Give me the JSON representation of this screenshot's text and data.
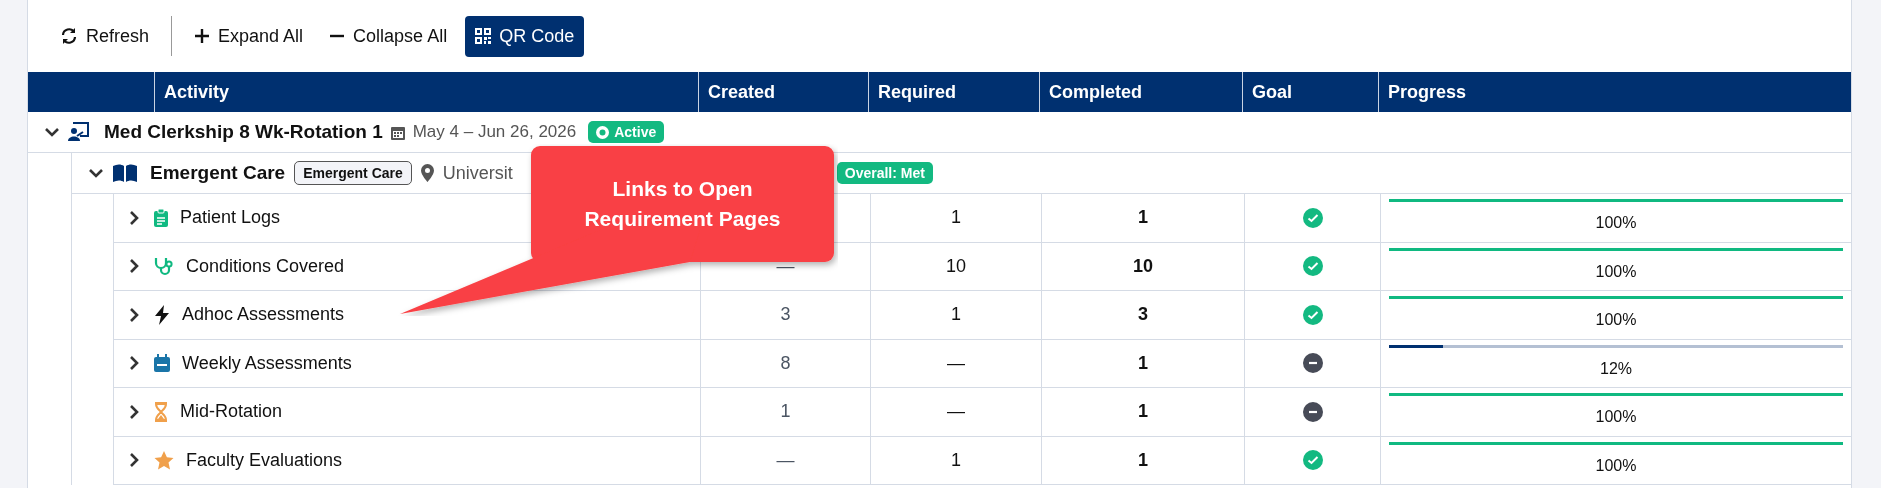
{
  "toolbar": {
    "buttons": [
      {
        "label": "Refresh",
        "kind": "refresh"
      },
      {
        "label": "Expand All",
        "kind": "expand"
      },
      {
        "label": "Collapse All",
        "kind": "collapse"
      },
      {
        "label": "QR Code",
        "kind": "qr"
      }
    ]
  },
  "table": {
    "columns": [
      "Activity",
      "Created",
      "Required",
      "Completed",
      "Goal",
      "Progress"
    ],
    "groups": [
      {
        "title": "Med Clerkship 8 Wk-Rotation 1",
        "dates": "May 4 – Jun 26, 2026",
        "status": "Active",
        "expanded": true,
        "children": [
          {
            "title": "Emergent Care",
            "tag": "Emergent Care",
            "location": "Universit",
            "overall": "Overall: Met",
            "expanded": true,
            "children": [
              {
                "name": "Patient Logs",
                "expanded": false,
                "required": "1",
                "completed": "1",
                "goal_met": true,
                "progress": {
                  "level": 1,
                  "label": "100%"
                }
              },
              {
                "name": "Conditions Covered",
                "expanded": false,
                "created": "—",
                "required": "10",
                "completed": "10",
                "goal_met": true,
                "progress": {
                  "level": 1,
                  "label": "100%"
                }
              },
              {
                "name": "Adhoc Assessments",
                "expanded": false,
                "created": "3",
                "required": "1",
                "completed": "3",
                "goal_met": true,
                "progress": {
                  "level": 1,
                  "label": "100%"
                }
              },
              {
                "name": "Weekly Assessments",
                "expanded": false,
                "created": "8",
                "required": "—",
                "completed": "1",
                "goal_met": false,
                "progress": {
                  "level": 0.12,
                  "label": "12%"
                }
              },
              {
                "name": "Mid-Rotation",
                "expanded": false,
                "created": "1",
                "required": "—",
                "completed": "1",
                "goal_met": false,
                "progress": {
                  "level": 1,
                  "label": "100%"
                }
              },
              {
                "name": "Faculty Evaluations",
                "expanded": false,
                "created": "—",
                "required": "1",
                "completed": "1",
                "goal_met": true,
                "progress": {
                  "level": 1,
                  "label": "100%"
                }
              }
            ]
          }
        ]
      }
    ]
  },
  "callout": {
    "text": "Links to Open\nRequirement Pages"
  }
}
